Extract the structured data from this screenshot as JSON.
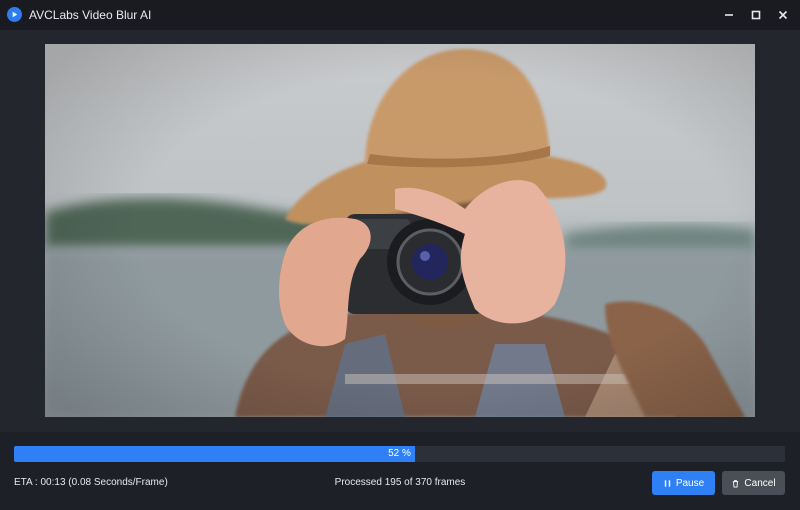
{
  "app": {
    "title": "AVCLabs Video Blur AI",
    "icon": "play-icon",
    "accent": "#2f80f5"
  },
  "window_controls": {
    "minimize": "minimize-icon",
    "maximize": "maximize-icon",
    "close": "close-icon"
  },
  "preview": {
    "content": "video-preview"
  },
  "progress": {
    "percent": 52,
    "label": "52 %"
  },
  "status": {
    "eta": "ETA : 00:13 (0.08 Seconds/Frame)",
    "processed": "Processed 195 of 370 frames"
  },
  "buttons": {
    "pause_label": "Pause",
    "pause_icon": "pause-icon",
    "cancel_label": "Cancel",
    "cancel_icon": "trash-icon"
  }
}
